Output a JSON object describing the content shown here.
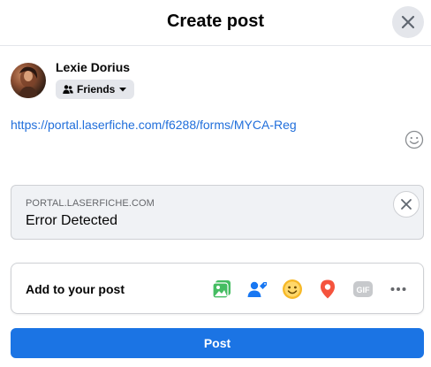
{
  "header": {
    "title": "Create post",
    "close_icon": "close-icon"
  },
  "user": {
    "name": "Lexie Dorius",
    "audience": "Friends"
  },
  "composer": {
    "text": "https://portal.laserfiche.com/f6288/forms/MYCA-Reg",
    "emoji_icon": "smiley-outline-icon"
  },
  "link_preview": {
    "domain": "PORTAL.LASERFICHE.COM",
    "title": "Error Detected"
  },
  "add_to_post": {
    "label": "Add to your post",
    "tools": [
      {
        "icon": "photo-video-icon",
        "color": "#45bd62"
      },
      {
        "icon": "tag-people-icon",
        "color": "#1877f2"
      },
      {
        "icon": "feeling-activity-icon",
        "color": "#f7b928"
      },
      {
        "icon": "check-in-icon",
        "color": "#f5533d"
      },
      {
        "icon": "gif-icon",
        "color": "#c7c9cc"
      },
      {
        "icon": "more-icon",
        "color": "#65676b"
      }
    ]
  },
  "post_button": {
    "label": "Post",
    "color": "#1b74e4"
  }
}
